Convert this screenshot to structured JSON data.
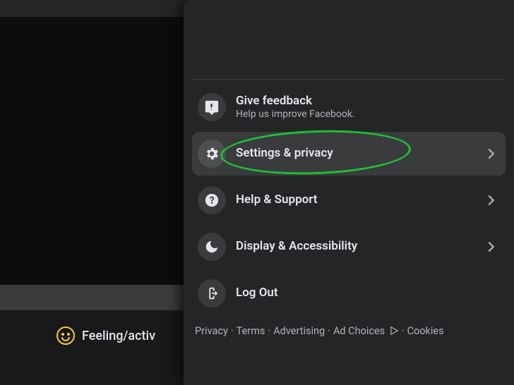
{
  "composer": {
    "feeling_label": "Feeling/activ"
  },
  "menu": {
    "feedback": {
      "label": "Give feedback",
      "sub": "Help us improve Facebook."
    },
    "settings": {
      "label": "Settings & privacy"
    },
    "help": {
      "label": "Help & Support"
    },
    "display": {
      "label": "Display & Accessibility"
    },
    "logout": {
      "label": "Log Out"
    }
  },
  "footer": {
    "privacy": "Privacy",
    "terms": "Terms",
    "advertising": "Advertising",
    "ad_choices": "Ad Choices",
    "cookies": "Cookies"
  }
}
